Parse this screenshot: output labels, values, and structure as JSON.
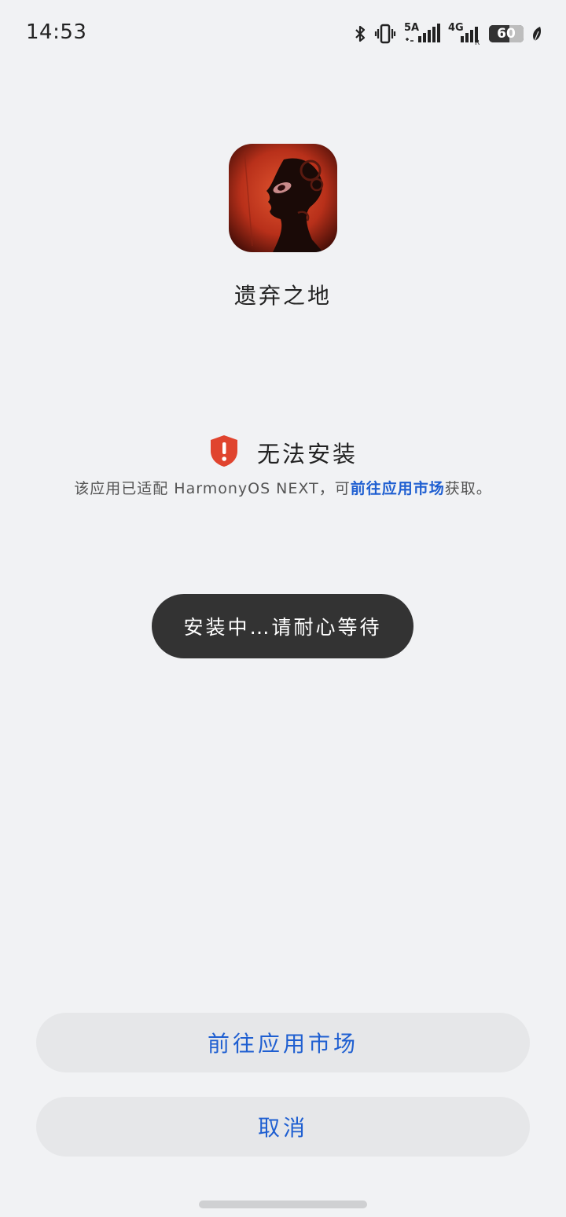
{
  "status_bar": {
    "time": "14:53",
    "network_5g": "5A",
    "network_4g": "4G",
    "battery_level": "60",
    "icons": [
      "bluetooth-icon",
      "vibrate-icon",
      "signal-5a-icon",
      "signal-4g-icon",
      "battery-icon",
      "leaf-icon"
    ]
  },
  "app": {
    "name": "遗弃之地"
  },
  "warning": {
    "title": "无法安装",
    "desc_prefix": "该应用已适配 HarmonyOS NEXT，可",
    "desc_link": "前往应用市场",
    "desc_suffix": "获取。",
    "icon": "shield-alert-icon",
    "icon_color": "#e0442e"
  },
  "toast": {
    "text": "安装中…请耐心等待"
  },
  "buttons": {
    "market": "前往应用市场",
    "cancel": "取消"
  },
  "colors": {
    "background": "#f1f2f4",
    "accent": "#1f5fd1",
    "toast_bg": "#333333",
    "button_bg": "#e6e7e9"
  }
}
